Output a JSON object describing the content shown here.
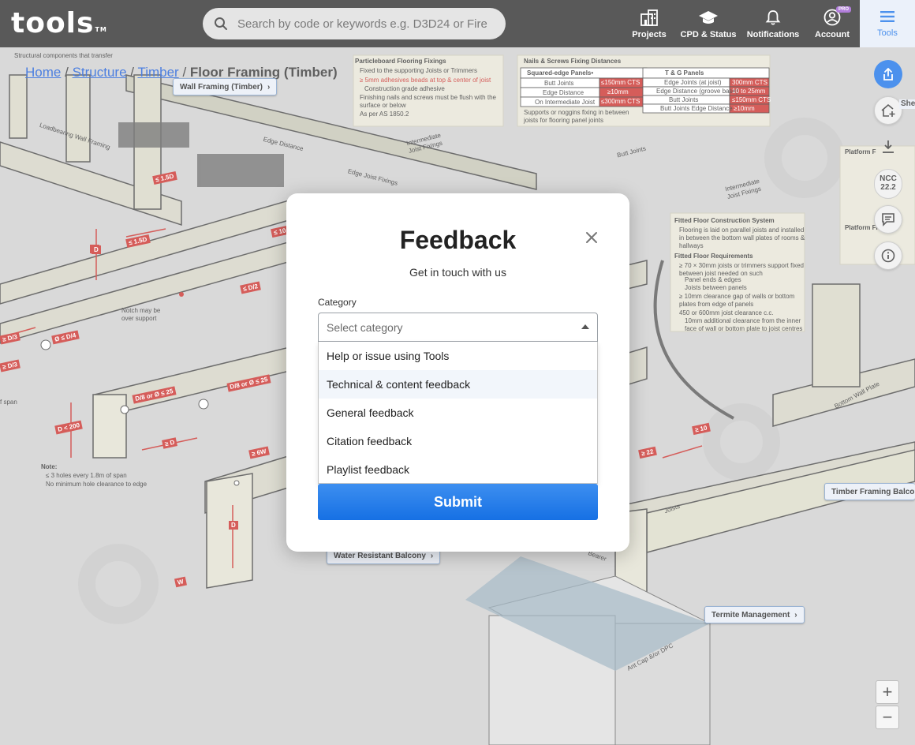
{
  "header": {
    "logo": "tools",
    "logo_mark": "TM",
    "search_placeholder": "Search by code or keywords e.g. D3D24 or Fire",
    "nav": {
      "projects": "Projects",
      "cpd": "CPD & Status",
      "notifications": "Notifications",
      "account": "Account",
      "account_badge": "PRO",
      "tools": "Tools"
    }
  },
  "breadcrumb": {
    "home": "Home",
    "structure": "Structure",
    "timber": "Timber",
    "current": "Floor Framing (Timber)",
    "sep": "/"
  },
  "diagram": {
    "chips": {
      "wall_framing": "Wall Framing (Timber)",
      "water_resistant": "Water Resistant Balcony",
      "termite": "Termite Management",
      "balconies": "Timber Framing Balconie"
    },
    "notes": {
      "top_left": "Structural components that transfer",
      "particleboard_title": "Particleboard Flooring Fixings",
      "particleboard_1": "Fixed to the supporting Joists or Trimmers",
      "particleboard_2": "≥ 5mm adhesives beads at top & center of joist",
      "particleboard_3": "Construction grade adhesive",
      "particleboard_4": "Finishing nails and screws must be flush with the surface or below",
      "particleboard_5": "As per AS 1850.2",
      "nails_title": "Nails & Screws Fixing Distances",
      "squared_edge": "Squared-edge Panels•",
      "tg_panels": "T & G Panels",
      "butt_joints": "Butt Joints",
      "edge_distance": "Edge Distance",
      "intermediate": "On Intermediate Joist",
      "edge_joints": "Edge Joints (at joist)",
      "edge_groove": "Edge Distance (groove base)",
      "butt_edge": "Butt Joints Edge Distance",
      "supports": "Supports or noggins fixing in between joists for flooring panel joints",
      "fitted_title": "Fitted Floor Construction System",
      "fitted_1": "Flooring is laid on parallel joists and installed in between the bottom wall plates of rooms & hallways",
      "fitted_req": "Fitted Floor Requirements",
      "fitted_2": "≥ 70 × 30mm joists or trimmers support fixed between joist needed on such",
      "fitted_3": "Panel ends & edges",
      "fitted_4": "Joists between panels",
      "fitted_5": "≥ 10mm clearance gap of walls or bottom plates from edge of panels",
      "fitted_6": "450 or 600mm joist clearance c.c.",
      "fitted_7": "10mm additional clearance from the inner face of wall or bottom plate to joist centres",
      "platform_title": "Platform F",
      "platform_req": "Platform Fl",
      "note_title": "Note:",
      "note_1": "≤ 3 holes every 1.8m of span",
      "note_2": "No minimum hole clearance to edge",
      "notch": "Notch may be over support",
      "span": "f span",
      "loadbearing": "Loadbearing Wall Framing",
      "edge_dist": "Edge Distance",
      "edge_joist": "Edge Joist Fixings",
      "intermediate_joist": "Intermediate Joist Fixings",
      "butt_joint": "Butt Joints",
      "bottom_plate": "Bottom Wall Plate",
      "joists": "Joists",
      "bearer": "Bearer",
      "ant_cap": "Ant Cap &/or DPC"
    },
    "values": {
      "v150": "≤150mm CTS",
      "v10": "≥10mm",
      "v300": "≤300mm CTS",
      "v300b": "300mm CTS",
      "v10to25": "10 to 25mm",
      "v150b": "≤150mm CTS",
      "v10b": "≥10mm",
      "d1": "≤ 1.5D",
      "d2": "≤ 1.5D",
      "d3": "D",
      "d4": "≥ D/3",
      "d5": "Ø ≤ D/4",
      "d6": "≥ D/3",
      "d7": "D/8 or Ø ≤ 25",
      "d8": "D/8 or Ø ≤ 25",
      "d9": "D < 200",
      "d10": "≥ D",
      "d11": "≤ D/2",
      "d12": "≥ 6W",
      "d13": "D",
      "d14": "W",
      "d15": "≥ 10",
      "d16": "≥ 22",
      "d17": "D",
      "d18": "≤ 10"
    }
  },
  "side": {
    "sheet": "Shee",
    "ncc_1": "NCC",
    "ncc_2": "22.2",
    "zoom_in": "+",
    "zoom_out": "−"
  },
  "modal": {
    "title": "Feedback",
    "subtitle": "Get in touch with us",
    "category_label": "Category",
    "select_placeholder": "Select category",
    "options": [
      "Help or issue using Tools",
      "Technical & content feedback",
      "General feedback",
      "Citation feedback",
      "Playlist feedback"
    ],
    "submit": "Submit"
  },
  "colors": {
    "topbar": "#2b2b2b",
    "accent": "#1a73e8",
    "red": "#c9302c"
  }
}
